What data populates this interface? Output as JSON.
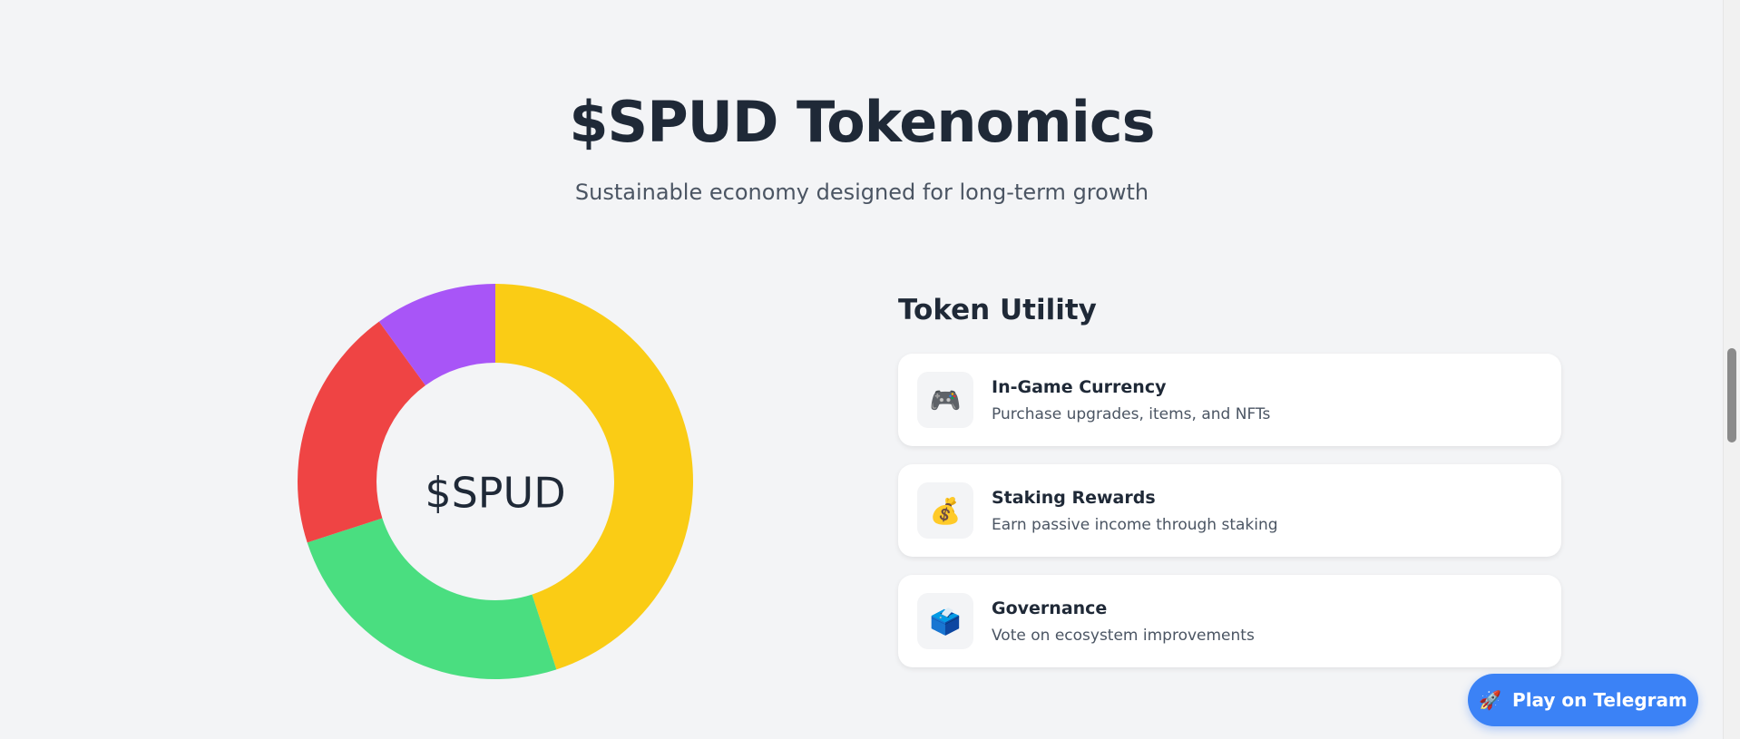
{
  "header": {
    "title": "$SPUD Tokenomics",
    "subtitle": "Sustainable economy designed for long-term growth"
  },
  "chart_data": {
    "type": "pie",
    "center_label": "$SPUD",
    "segments": [
      {
        "value": 45,
        "color": "#facc15"
      },
      {
        "value": 25,
        "color": "#4ade80"
      },
      {
        "value": 20,
        "color": "#ef4444"
      },
      {
        "value": 10,
        "color": "#a855f7"
      }
    ]
  },
  "utility": {
    "title": "Token Utility",
    "items": [
      {
        "icon": "game-controller-icon",
        "glyph": "🎮",
        "title": "In-Game Currency",
        "description": "Purchase upgrades, items, and NFTs"
      },
      {
        "icon": "money-bag-icon",
        "glyph": "💰",
        "title": "Staking Rewards",
        "description": "Earn passive income through staking"
      },
      {
        "icon": "ballot-box-icon",
        "glyph": "🗳️",
        "title": "Governance",
        "description": "Vote on ecosystem improvements"
      }
    ]
  },
  "cta": {
    "label": "Play on Telegram",
    "icon": "telegram-plane-icon",
    "glyph": "🚀",
    "color": "#3b82f6"
  }
}
